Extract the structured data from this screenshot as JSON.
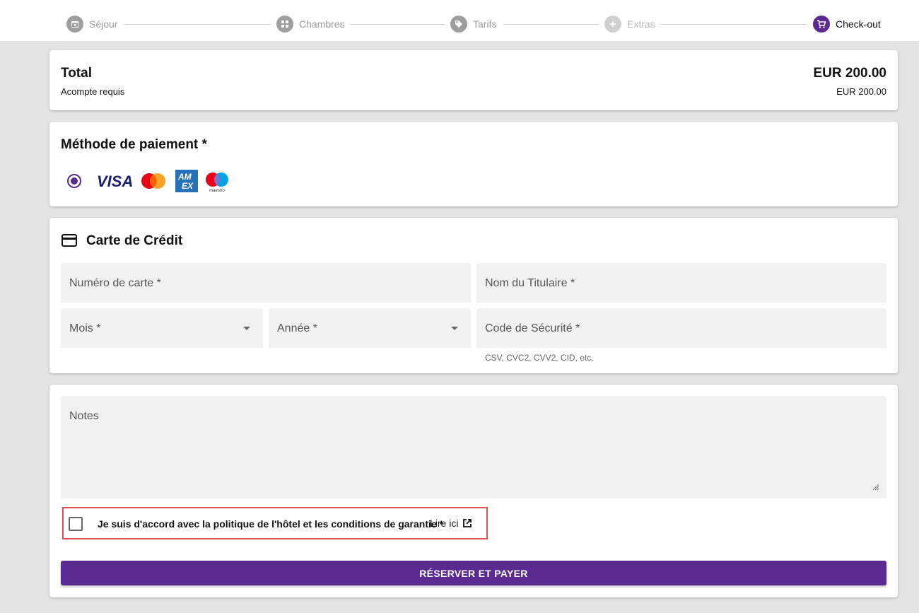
{
  "stepper": {
    "steps": [
      {
        "label": "Séjour",
        "icon": "calendar-icon",
        "state": "done"
      },
      {
        "label": "Chambres",
        "icon": "grid-icon",
        "state": "done"
      },
      {
        "label": "Tarifs",
        "icon": "tag-icon",
        "state": "done"
      },
      {
        "label": "Extras",
        "icon": "plus-icon",
        "state": "upcoming"
      },
      {
        "label": "Check-out",
        "icon": "cart-icon",
        "state": "active"
      }
    ]
  },
  "summary": {
    "title": "Total",
    "amount": "EUR 200.00",
    "deposit_label": "Acompte requis",
    "deposit_amount": "EUR 200.00"
  },
  "payment_method": {
    "title": "Méthode de paiement *",
    "selected": true,
    "brands": [
      "visa-logo",
      "mastercard-logo",
      "amex-logo",
      "maestro-logo"
    ],
    "visa_text": "VISA",
    "amex_text": "AM EX",
    "maestro_text": "maestro"
  },
  "credit_card": {
    "title": "Carte de Crédit",
    "card_number_label": "Numéro de carte *",
    "holder_label": "Nom du Titulaire *",
    "month_label": "Mois *",
    "year_label": "Année *",
    "cvc_label": "Code de Sécurité *",
    "cvc_hint": "CSV, CVC2, CVV2, CID, etc."
  },
  "notes": {
    "label": "Notes"
  },
  "agreement": {
    "text": "Je suis d'accord avec la politique de l'hôtel et les conditions de garantie *",
    "link_label": "Lire ici",
    "checked": false
  },
  "submit": {
    "label": "RÉSERVER ET PAYER"
  },
  "colors": {
    "accent": "#5b2a91",
    "highlight": "#e05050"
  }
}
